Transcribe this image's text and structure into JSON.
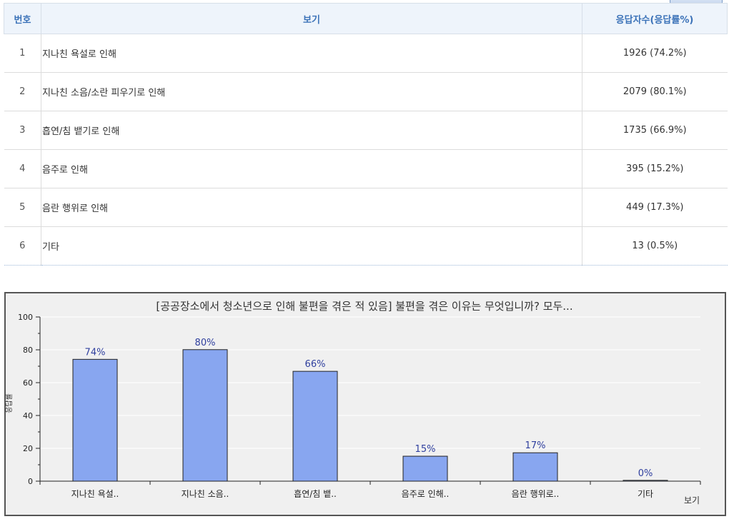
{
  "table": {
    "headers": {
      "num": "번호",
      "option": "보기",
      "count": "응답자수(응답률%)"
    },
    "rows": [
      {
        "num": "1",
        "label": "지나친 욕설로 인해",
        "count": "1926 (74.2%)"
      },
      {
        "num": "2",
        "label": "지나친 소음/소란 피우기로 인해",
        "count": "2079 (80.1%)"
      },
      {
        "num": "3",
        "label": "흡연/침 뱉기로 인해",
        "count": "1735 (66.9%)"
      },
      {
        "num": "4",
        "label": "음주로 인해",
        "count": "395 (15.2%)"
      },
      {
        "num": "5",
        "label": "음란 행위로 인해",
        "count": "449 (17.3%)"
      },
      {
        "num": "6",
        "label": "기타",
        "count": "13 (0.5%)"
      }
    ]
  },
  "chart_data": {
    "type": "bar",
    "title": "[공공장소에서 청소년으로 인해 불편을 겪은 적 있음] 불편을 겪은 이유는 무엇입니까? 모두...",
    "categories": [
      "지나친 욕설..",
      "지나친 소음..",
      "흡연/침 뱉..",
      "음주로 인해..",
      "음란 행위로..",
      "기타"
    ],
    "values": [
      74,
      80,
      66,
      15,
      17,
      0
    ],
    "bar_heights": [
      74.2,
      80.1,
      66.9,
      15.2,
      17.3,
      0.5
    ],
    "data_labels": [
      "74%",
      "80%",
      "66%",
      "15%",
      "17%",
      "0%"
    ],
    "xlabel": "보기",
    "ylabel": "응답률",
    "ylim": [
      0,
      100
    ],
    "yticks": [
      "0",
      "20",
      "40",
      "60",
      "80",
      "100"
    ],
    "grid": true,
    "colors": {
      "bar": "#88a6f0",
      "bar_stroke": "#222222",
      "label": "#2f3f9e"
    }
  }
}
